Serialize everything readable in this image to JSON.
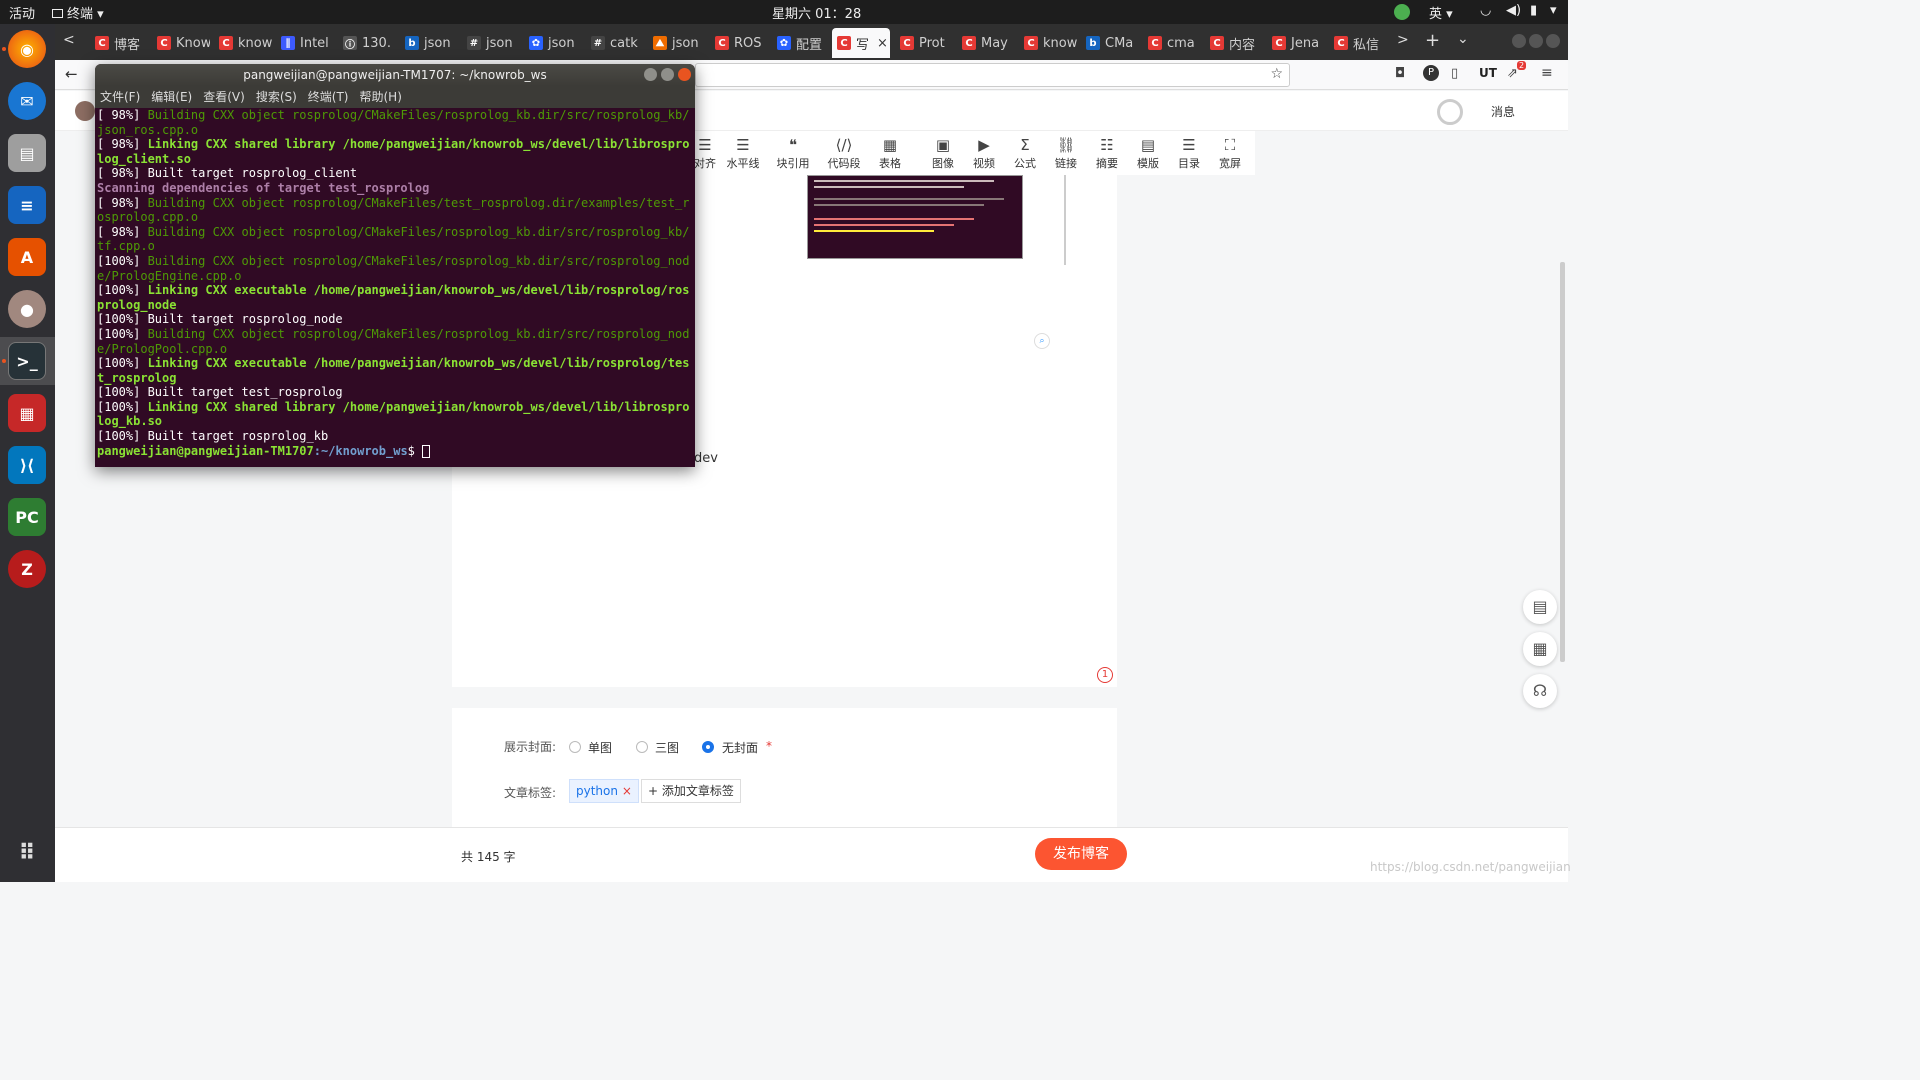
{
  "topbar": {
    "activities": "活动",
    "app": "终端 ▾",
    "clock": "星期六 01：28",
    "lang": "英 ▾"
  },
  "browser": {
    "tabs": [
      {
        "label": "博客",
        "fav": "C",
        "color": "#e53935"
      },
      {
        "label": "Know",
        "fav": "C",
        "color": "#e53935"
      },
      {
        "label": "know",
        "fav": "C",
        "color": "#e53935"
      },
      {
        "label": "Intel",
        "fav": "∥",
        "color": "#3d5afe"
      },
      {
        "label": "130.",
        "fav": "ⓘ",
        "color": "#555"
      },
      {
        "label": "json",
        "fav": "b",
        "color": "#1565c0"
      },
      {
        "label": "json",
        "fav": "#",
        "color": "#444"
      },
      {
        "label": "json",
        "fav": "✿",
        "color": "#2962ff"
      },
      {
        "label": "catk",
        "fav": "#",
        "color": "#444"
      },
      {
        "label": "json",
        "fav": "⛰",
        "color": "#ef6c00"
      },
      {
        "label": "ROS",
        "fav": "C",
        "color": "#e53935"
      },
      {
        "label": "配置",
        "fav": "✿",
        "color": "#2962ff"
      },
      {
        "label": "写",
        "fav": "C",
        "color": "#e53935"
      },
      {
        "label": "Prot",
        "fav": "C",
        "color": "#e53935"
      },
      {
        "label": "May",
        "fav": "C",
        "color": "#e53935"
      },
      {
        "label": "know",
        "fav": "C",
        "color": "#e53935"
      },
      {
        "label": "CMa",
        "fav": "b",
        "color": "#1565c0"
      },
      {
        "label": "cma",
        "fav": "C",
        "color": "#e53935"
      },
      {
        "label": "内容",
        "fav": "C",
        "color": "#e53935"
      },
      {
        "label": "Jena",
        "fav": "C",
        "color": "#e53935"
      },
      {
        "label": "私信",
        "fav": "C",
        "color": "#e53935"
      }
    ],
    "active_tab": 12,
    "notif_count": "2"
  },
  "page": {
    "messages_label": "消息",
    "toolbar": [
      "对齐",
      "水平线",
      "块引用",
      "代码段",
      "表格",
      "图像",
      "视频",
      "公式",
      "链接",
      "摘要",
      "模版",
      "目录",
      "宽屏"
    ],
    "doc_visible_text": "dev",
    "comment_count": "1",
    "cover_label": "展示封面:",
    "cover_options": [
      "单图",
      "三图",
      "无封面"
    ],
    "cover_selected": 2,
    "required_mark": "*",
    "tags_label": "文章标签:",
    "tag": "python",
    "add_tag": "+ 添加文章标签",
    "word_count": "共 145 字",
    "publish": "发布博客",
    "watermark": "https://blog.csdn.net/pangweijian"
  },
  "terminal": {
    "title": "pangweijian@pangweijian-TM1707: ~/knowrob_ws",
    "menu": [
      "文件(F)",
      "编辑(E)",
      "查看(V)",
      "搜索(S)",
      "终端(T)",
      "帮助(H)"
    ],
    "lines": [
      {
        "prefix": "[ 98%] ",
        "text": "Building CXX object rosprolog/CMakeFiles/rosprolog_kb.dir/src/rosprolog_kb/json_ros.cpp.o",
        "style": "dgreen"
      },
      {
        "prefix": "[ 98%] ",
        "text": "Linking CXX shared library /home/pangweijian/knowrob_ws/devel/lib/librosprolog_client.so",
        "style": "green"
      },
      {
        "prefix": "[ 98%] ",
        "text": "Built target rosprolog_client",
        "style": "plain"
      },
      {
        "prefix": "",
        "text": "Scanning dependencies of target test_rosprolog",
        "style": "magenta"
      },
      {
        "prefix": "[ 98%] ",
        "text": "Building CXX object rosprolog/CMakeFiles/test_rosprolog.dir/examples/test_rosprolog.cpp.o",
        "style": "dgreen"
      },
      {
        "prefix": "[ 98%] ",
        "text": "Building CXX object rosprolog/CMakeFiles/rosprolog_kb.dir/src/rosprolog_kb/tf.cpp.o",
        "style": "dgreen"
      },
      {
        "prefix": "[100%] ",
        "text": "Building CXX object rosprolog/CMakeFiles/rosprolog_kb.dir/src/rosprolog_node/PrologEngine.cpp.o",
        "style": "dgreen"
      },
      {
        "prefix": "[100%] ",
        "text": "Linking CXX executable /home/pangweijian/knowrob_ws/devel/lib/rosprolog/rosprolog_node",
        "style": "green"
      },
      {
        "prefix": "[100%] ",
        "text": "Built target rosprolog_node",
        "style": "plain"
      },
      {
        "prefix": "[100%] ",
        "text": "Building CXX object rosprolog/CMakeFiles/rosprolog_kb.dir/src/rosprolog_node/PrologPool.cpp.o",
        "style": "dgreen"
      },
      {
        "prefix": "[100%] ",
        "text": "Linking CXX executable /home/pangweijian/knowrob_ws/devel/lib/rosprolog/test_rosprolog",
        "style": "green"
      },
      {
        "prefix": "[100%] ",
        "text": "Built target test_rosprolog",
        "style": "plain"
      },
      {
        "prefix": "[100%] ",
        "text": "Linking CXX shared library /home/pangweijian/knowrob_ws/devel/lib/librosprolog_kb.so",
        "style": "green"
      },
      {
        "prefix": "[100%] ",
        "text": "Built target rosprolog_kb",
        "style": "plain"
      }
    ],
    "prompt_user": "pangweijian@pangweijian-TM1707",
    "prompt_path": ":~/knowrob_ws",
    "prompt_end": "$ "
  }
}
